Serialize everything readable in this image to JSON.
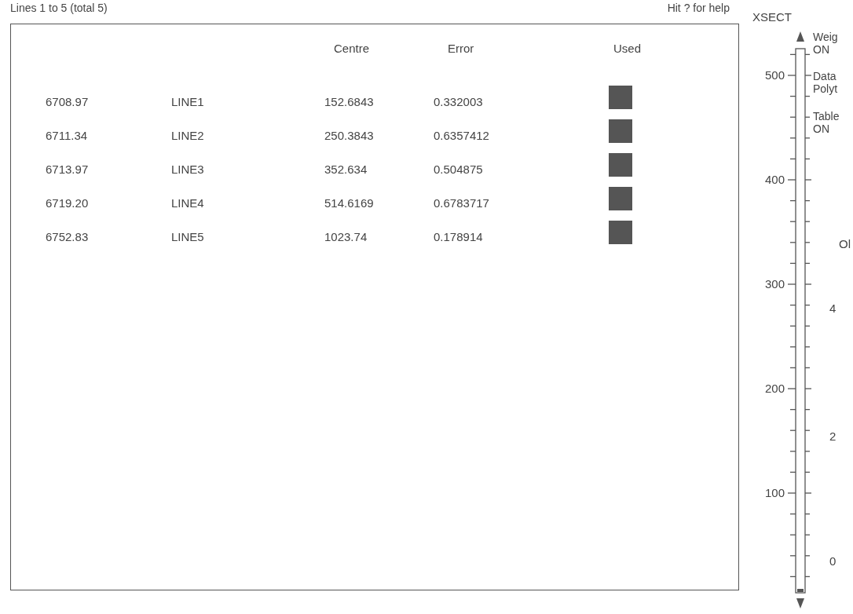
{
  "status": {
    "range": "Lines 1 to 5 (total 5)",
    "help": "Hit ? for help"
  },
  "table": {
    "columns": [
      "Centre",
      "Error",
      "Used"
    ],
    "rows": [
      {
        "column_1": "6708.97",
        "column_2": "LINE1",
        "centre": "152.6843",
        "error": "0.332003",
        "used": true
      },
      {
        "column_1": "6711.34",
        "column_2": "LINE2",
        "centre": "250.3843",
        "error": "0.6357412",
        "used": true
      },
      {
        "column_1": "6713.97",
        "column_2": "LINE3",
        "centre": "352.634",
        "error": "0.504875",
        "used": true
      },
      {
        "column_1": "6719.20",
        "column_2": "LINE4",
        "centre": "514.6169",
        "error": "0.6783717",
        "used": true
      },
      {
        "column_1": "6752.83",
        "column_2": "LINE5",
        "centre": "1023.74",
        "error": "0.178914",
        "used": true
      }
    ]
  },
  "scale": {
    "title": "XSECT",
    "axis_labels": [
      "500",
      "400",
      "300",
      "200",
      "100"
    ],
    "side_labels": [
      "Weig",
      "ON",
      "Data",
      "Polyt",
      "Table",
      "ON",
      "Ol",
      "4",
      "2",
      "0"
    ]
  }
}
